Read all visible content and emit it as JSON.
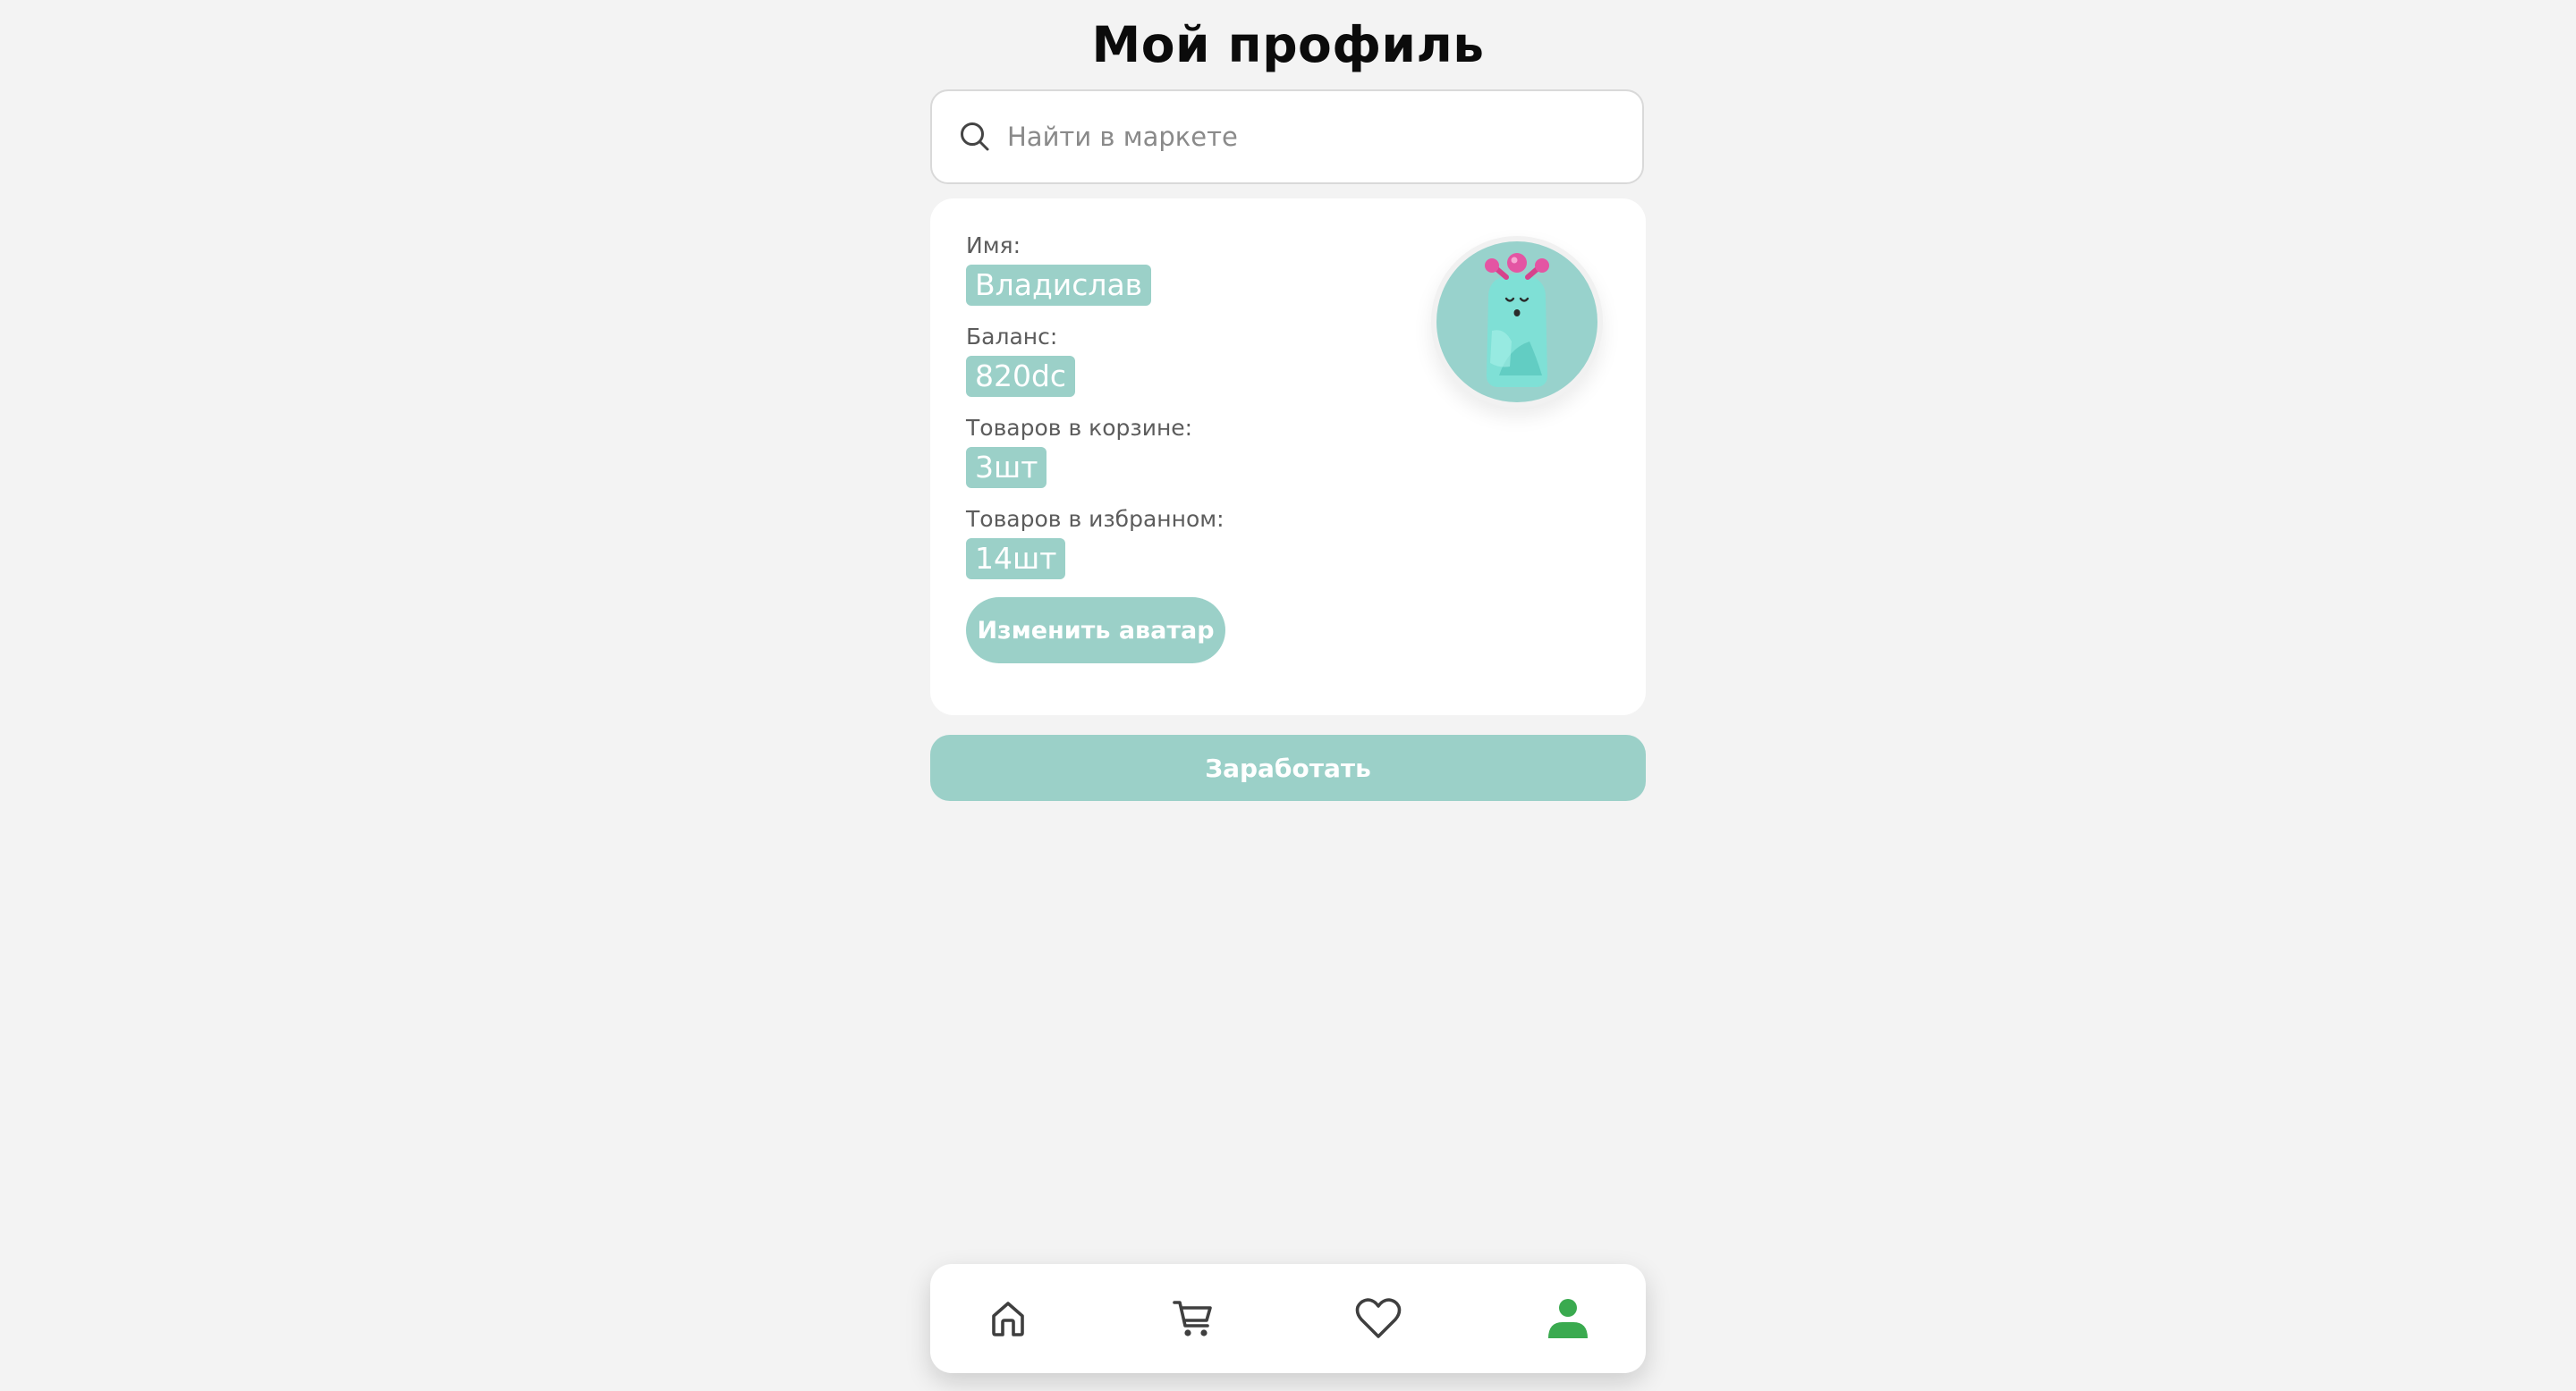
{
  "header": {
    "title": "Мой профиль"
  },
  "search": {
    "placeholder": "Найти в маркете",
    "value": ""
  },
  "profile": {
    "name_label": "Имя:",
    "name_value": "Владислав",
    "balance_label": "Баланс:",
    "balance_value": "820dc",
    "cart_label": "Товаров в корзине:",
    "cart_value": "3шт",
    "favorites_label": "Товаров в избранном:",
    "favorites_value": "14шт",
    "change_avatar_label": "Изменить аватар"
  },
  "earn_button": {
    "label": "Заработать"
  },
  "bottom_nav": {
    "items": [
      {
        "icon": "home-icon",
        "active": false
      },
      {
        "icon": "cart-icon",
        "active": false
      },
      {
        "icon": "heart-icon",
        "active": false
      },
      {
        "icon": "user-icon",
        "active": true
      }
    ]
  },
  "colors": {
    "accent": "#9bd0c8",
    "active_nav": "#3aaa4f",
    "inactive_nav": "#3f3f3f",
    "background": "#f3f3f3"
  }
}
